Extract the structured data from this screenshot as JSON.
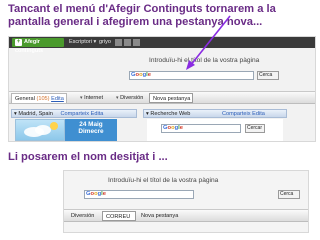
{
  "captions": {
    "top": "Tancant el menú d'Afegir Continguts tornarem a la pantalla general i afegirem una pestanya nova...",
    "bottom": "Li posarem el nom desitjat i ..."
  },
  "top_screenshot": {
    "toolbar": {
      "add_content": "Afegir continguts",
      "item1": "Escriptori ▾",
      "item2": "griyo"
    },
    "banner_text": "Introduïu-hi el títol de la vostra pàgina",
    "search_button": "Cerca",
    "tabs": [
      {
        "label": "General",
        "count": "(105)",
        "edit": "Edita"
      },
      {
        "label": "Internet"
      },
      {
        "label": "Diversión"
      },
      {
        "label": "Nova pestanya"
      }
    ],
    "gadgets": [
      {
        "title": "Madrid, Spain",
        "links": "Comparteix  Edita"
      },
      {
        "title": "Recherche Web",
        "links": "Comparteix  Edita"
      }
    ],
    "date": "24 Maig",
    "date_sub": "Dimecre",
    "mini_search_button": "Cercar"
  },
  "bottom_screenshot": {
    "banner_text": "Introduïu-hi el títol de la vostra pàgina",
    "search_button": "Cerca",
    "tabs": [
      {
        "label": "Diversión"
      },
      {
        "label": "CORREU"
      },
      {
        "label": "Nova pestanya"
      }
    ]
  },
  "colors": {
    "caption": "#6a2c86",
    "arrow": "#8a2be2",
    "add_button": "#4a9a2c"
  }
}
